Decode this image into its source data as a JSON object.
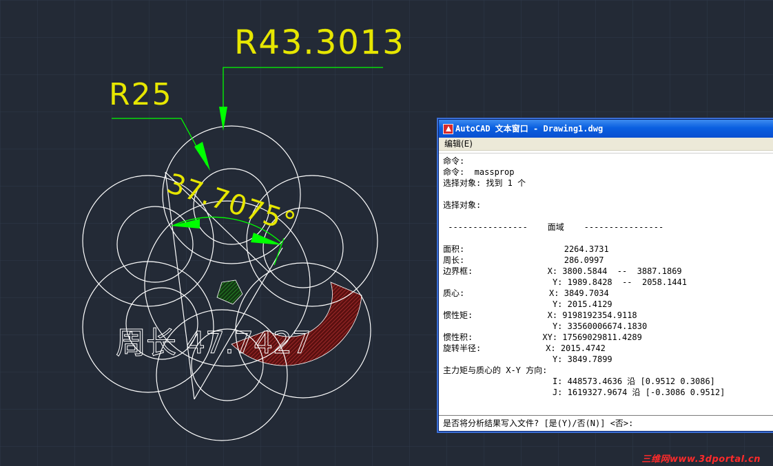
{
  "drawing": {
    "dim_r_large": "R43.3013",
    "dim_r_small": "R25",
    "dim_angle": "37.7075°",
    "perimeter_label": "周长 47.7427",
    "colors": {
      "background": "#232a36",
      "geometry": "#ffffff",
      "dimension_text": "#ffff00",
      "dimension_lines": "#00ff00",
      "hatch_red": "#7d1a1a",
      "hatch_green": "#1f6b1f"
    }
  },
  "text_window": {
    "title": "AutoCAD 文本窗口 - Drawing1.dwg",
    "menu_edit": "编辑(E)",
    "lines": [
      "命令:",
      "命令:  massprop",
      "选择对象: 找到 1 个",
      "",
      "选择对象:",
      "",
      " ----------------    面域    ----------------",
      "",
      "面积:                    2264.3731",
      "周长:                    286.0997",
      "边界框:               X: 3800.5844  --  3887.1869",
      "                      Y: 1989.8428  --  2058.1441",
      "质心:                 X: 3849.7034",
      "                      Y: 2015.4129",
      "惯性矩:               X: 9198192354.9118",
      "                      Y: 33560006674.1830",
      "惯性积:              XY: 17569029811.4289",
      "旋转半径:             X: 2015.4742",
      "                      Y: 3849.7899",
      "主力矩与质心的 X-Y 方向:",
      "                      I: 448573.4636 沿 [0.9512 0.3086]",
      "                      J: 1619327.9674 沿 [-0.3086 0.9512]"
    ],
    "prompt": "是否将分析结果写入文件? [是(Y)/否(N)] <否>:"
  },
  "watermark": "三维网www.3dportal.cn"
}
